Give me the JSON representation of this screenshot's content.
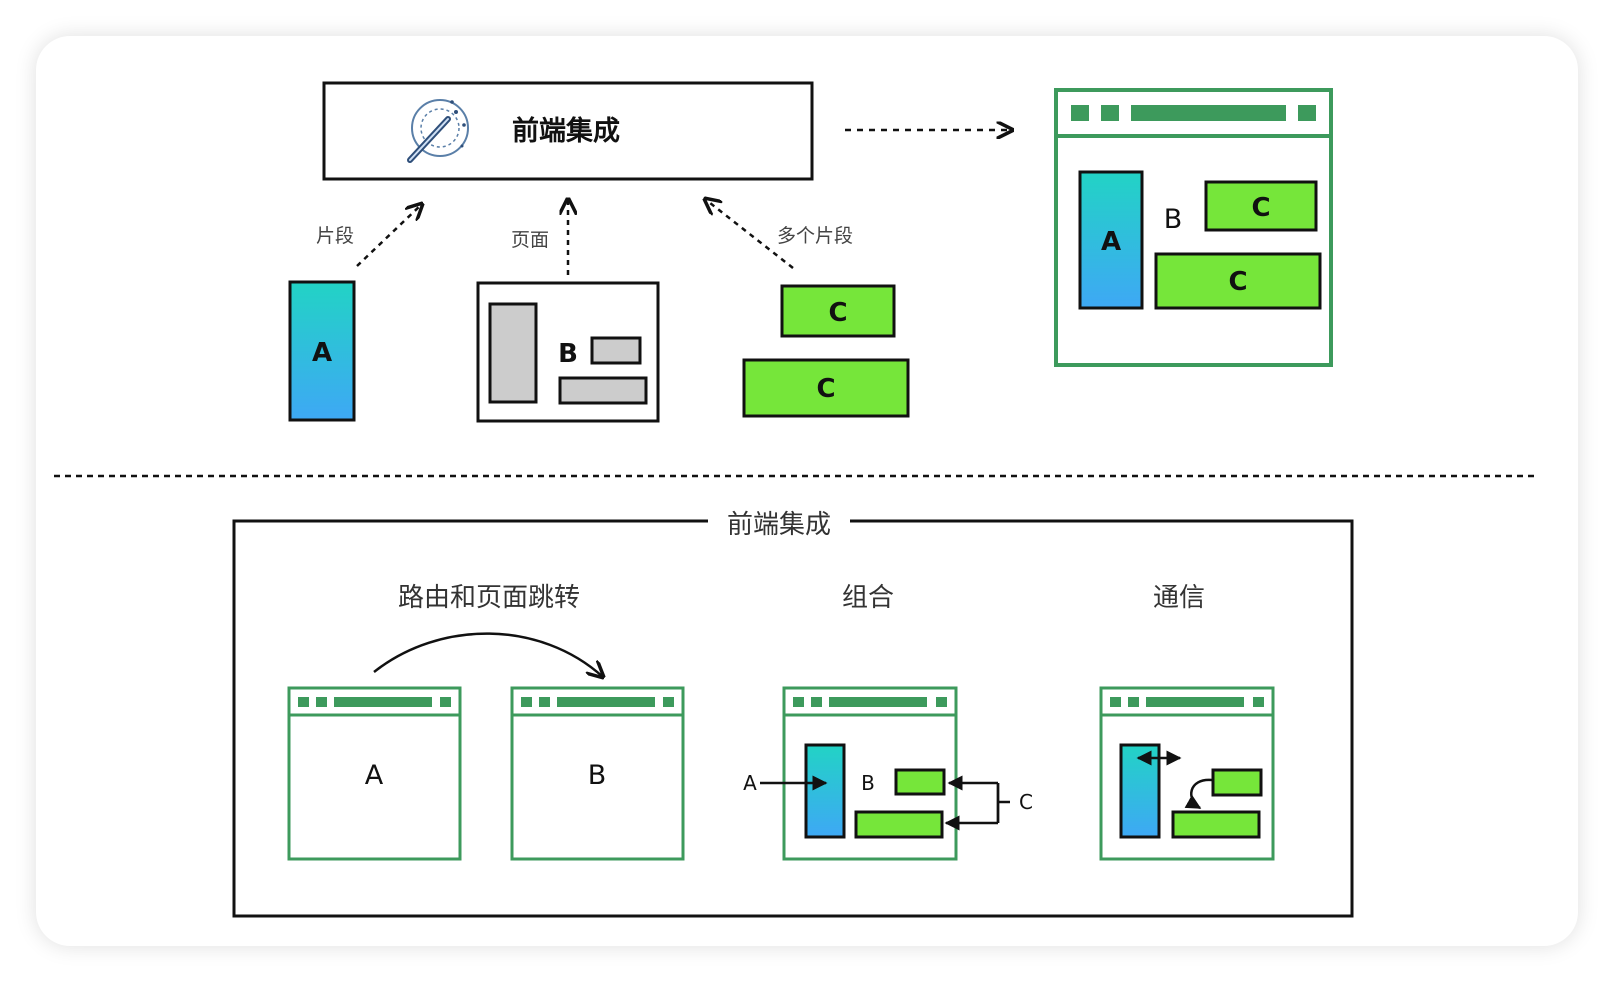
{
  "top": {
    "integration_title": "前端集成",
    "arrow_fragment_label": "片段",
    "arrow_page_label": "页面",
    "arrow_multi_label": "多个片段",
    "fragment_a": "A",
    "page_b": "B",
    "fragment_c1": "C",
    "fragment_c2": "C",
    "result_a": "A",
    "result_b": "B",
    "result_c1": "C",
    "result_c2": "C"
  },
  "bottom": {
    "group_title": "前端集成",
    "routing_title": "路由和页面跳转",
    "composition_title": "组合",
    "communication_title": "通信",
    "route_page_a": "A",
    "route_page_b": "B",
    "compose_label_a": "A",
    "compose_label_b": "B",
    "compose_label_c": "C"
  },
  "colors": {
    "browser_green": "#3d9a5c",
    "fragment_green": "#76e63a",
    "gradient_top": "#22d3c5",
    "gradient_bottom": "#3ea8f5",
    "placeholder_gray": "#cccccc"
  },
  "icons": [
    "magic-wand-icon"
  ]
}
